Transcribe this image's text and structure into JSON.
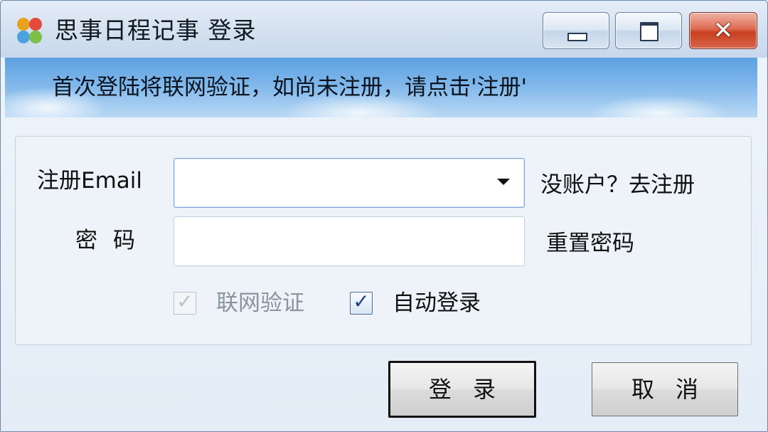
{
  "window": {
    "title": "思事日程记事 登录",
    "controls": {
      "minimize": "minimize",
      "maximize": "maximize",
      "close": "✕"
    }
  },
  "banner": {
    "text": "首次登陆将联网验证，如尚未注册，请点击'注册'"
  },
  "form": {
    "email_label": "注册Email",
    "email_value": "",
    "password_label": "密码",
    "password_value": "",
    "register_link": "没账户？去注册",
    "reset_link": "重置密码",
    "online_verify": {
      "label": "联网验证",
      "checked": true,
      "disabled": true
    },
    "auto_login": {
      "label": "自动登录",
      "checked": true
    }
  },
  "buttons": {
    "login": "登录",
    "cancel": "取消"
  },
  "icons": {
    "app": "app-logo-icon",
    "dropdown": "chevron-down-icon",
    "check": "✓"
  },
  "colors": {
    "banner_top": "#5da0e0",
    "close_button": "#c9401f",
    "checkbox_mark": "#1f3f8a"
  }
}
